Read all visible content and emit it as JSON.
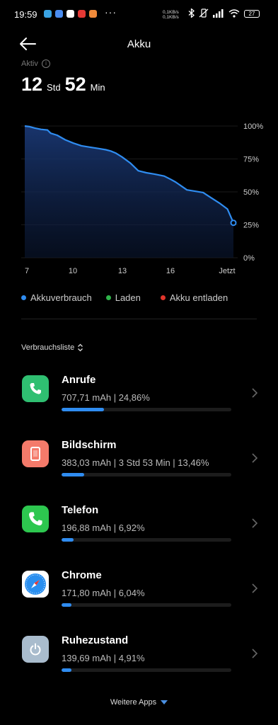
{
  "status_bar": {
    "time": "19:59",
    "more": "···",
    "speed_up": "0,1KB/s",
    "speed_down": "0,1KB/s",
    "battery": "27"
  },
  "header": {
    "title": "Akku"
  },
  "summary": {
    "label": "Aktiv",
    "hours": "12",
    "hours_unit": "Std",
    "minutes": "52",
    "minutes_unit": "Min"
  },
  "chart_data": {
    "type": "area",
    "x_ticks": [
      "7",
      "10",
      "13",
      "16",
      "Jetzt"
    ],
    "y_ticks": [
      "100%",
      "75%",
      "50%",
      "25%",
      "0%"
    ],
    "ylim": [
      0,
      100
    ],
    "x": [
      0,
      0.3,
      0.6,
      1.0,
      1.4,
      1.6,
      2.0,
      2.5,
      3.0,
      3.5,
      4.0,
      4.5,
      5.0,
      5.3,
      5.6,
      6.0,
      6.5,
      7.0,
      7.5,
      8.0,
      8.6,
      9.0,
      9.3,
      10.0,
      10.5,
      11.0,
      11.5,
      12.0,
      12.5,
      12.87
    ],
    "y": [
      100,
      99.5,
      98.5,
      97.5,
      97,
      94.5,
      93,
      89.5,
      87,
      85,
      84,
      83,
      82,
      81,
      79.5,
      76.5,
      72,
      66,
      64.5,
      63.5,
      62,
      59.5,
      57.5,
      51.5,
      50.5,
      49.5,
      45.5,
      41.5,
      37,
      26.5
    ],
    "series": [
      {
        "name": "Akkuverbrauch",
        "color": "#2f8cf0"
      }
    ],
    "grid": true
  },
  "legend": {
    "items": [
      {
        "label": "Akkuverbrauch",
        "color": "#2f8cf0"
      },
      {
        "label": "Laden",
        "color": "#2fb44a"
      },
      {
        "label": "Akku entladen",
        "color": "#e0352b"
      }
    ]
  },
  "sort": {
    "label": "Verbrauchsliste"
  },
  "apps": [
    {
      "name": "Anrufe",
      "detail": "707,71 mAh | 24,86%",
      "share": 0.2486,
      "icon": "phone-icon",
      "icon_bg": "#2fbf71"
    },
    {
      "name": "Bildschirm",
      "detail": "383,03 mAh | 3 Std 53 Min  | 13,46%",
      "share": 0.1346,
      "icon": "screen-icon",
      "icon_bg": "#f47a6a"
    },
    {
      "name": "Telefon",
      "detail": "196,88 mAh | 6,92%",
      "share": 0.0692,
      "icon": "phone-app-icon",
      "icon_bg": "#2dc74f"
    },
    {
      "name": "Chrome",
      "detail": "171,80 mAh | 6,04%",
      "share": 0.0604,
      "icon": "compass-icon",
      "icon_bg": "#ffffff"
    },
    {
      "name": "Ruhezustand",
      "detail": "139,69 mAh | 4,91%",
      "share": 0.0491,
      "icon": "power-icon",
      "icon_bg": "#a9bccd"
    }
  ],
  "more_apps": {
    "label": "Weitere Apps"
  }
}
